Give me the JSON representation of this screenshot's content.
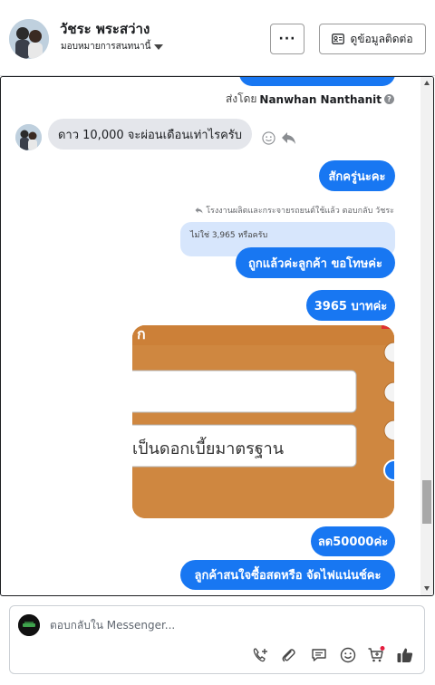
{
  "header": {
    "name": "วัชระ พระสว่าง",
    "assigned": "มอบหมายการสนทนานี้",
    "more_label": "···",
    "contact_label": "ดูข้อมูลติดต่อ"
  },
  "chat": {
    "sent_by_prefix": "ส่งโดย",
    "sent_by_name": "Nanwhan Nanthanit",
    "info_icon": "?",
    "messages": {
      "in1": "ดาว 10,000 จะผ่อนเดือนเท่าไรครับ",
      "out1": "สักครู่นะคะ",
      "reply_note": "โรงงานผลิตและกระจายรถยนต์ใช้แล้ว ตอบกลับ วัชระ",
      "quote": "ไม่ใช่ 3,965 หรือครับ",
      "out2": "ถูกแล้วค่ะลูกค้า ขอโทษค่ะ",
      "out3": "3965 บาทค่ะ",
      "out4": "ลด50000ค่ะ",
      "out5": "ลูกค้าสนใจซื้อสดหรือ จัดไฟแน่นช์คะ"
    },
    "image": {
      "corner_text": "ก",
      "field2_text": "เป็นดอกเบี้ยมาตรฐาน"
    }
  },
  "composer": {
    "placeholder": "ตอบกลับใน Messenger..."
  },
  "icons": {
    "smile": "smile-icon",
    "reply": "reply-icon",
    "contact": "contact-card-icon"
  },
  "colors": {
    "accent": "#1877f2",
    "incoming": "#e4e6eb",
    "quote": "#d7e6fc",
    "image_bg": "#cf8740"
  }
}
